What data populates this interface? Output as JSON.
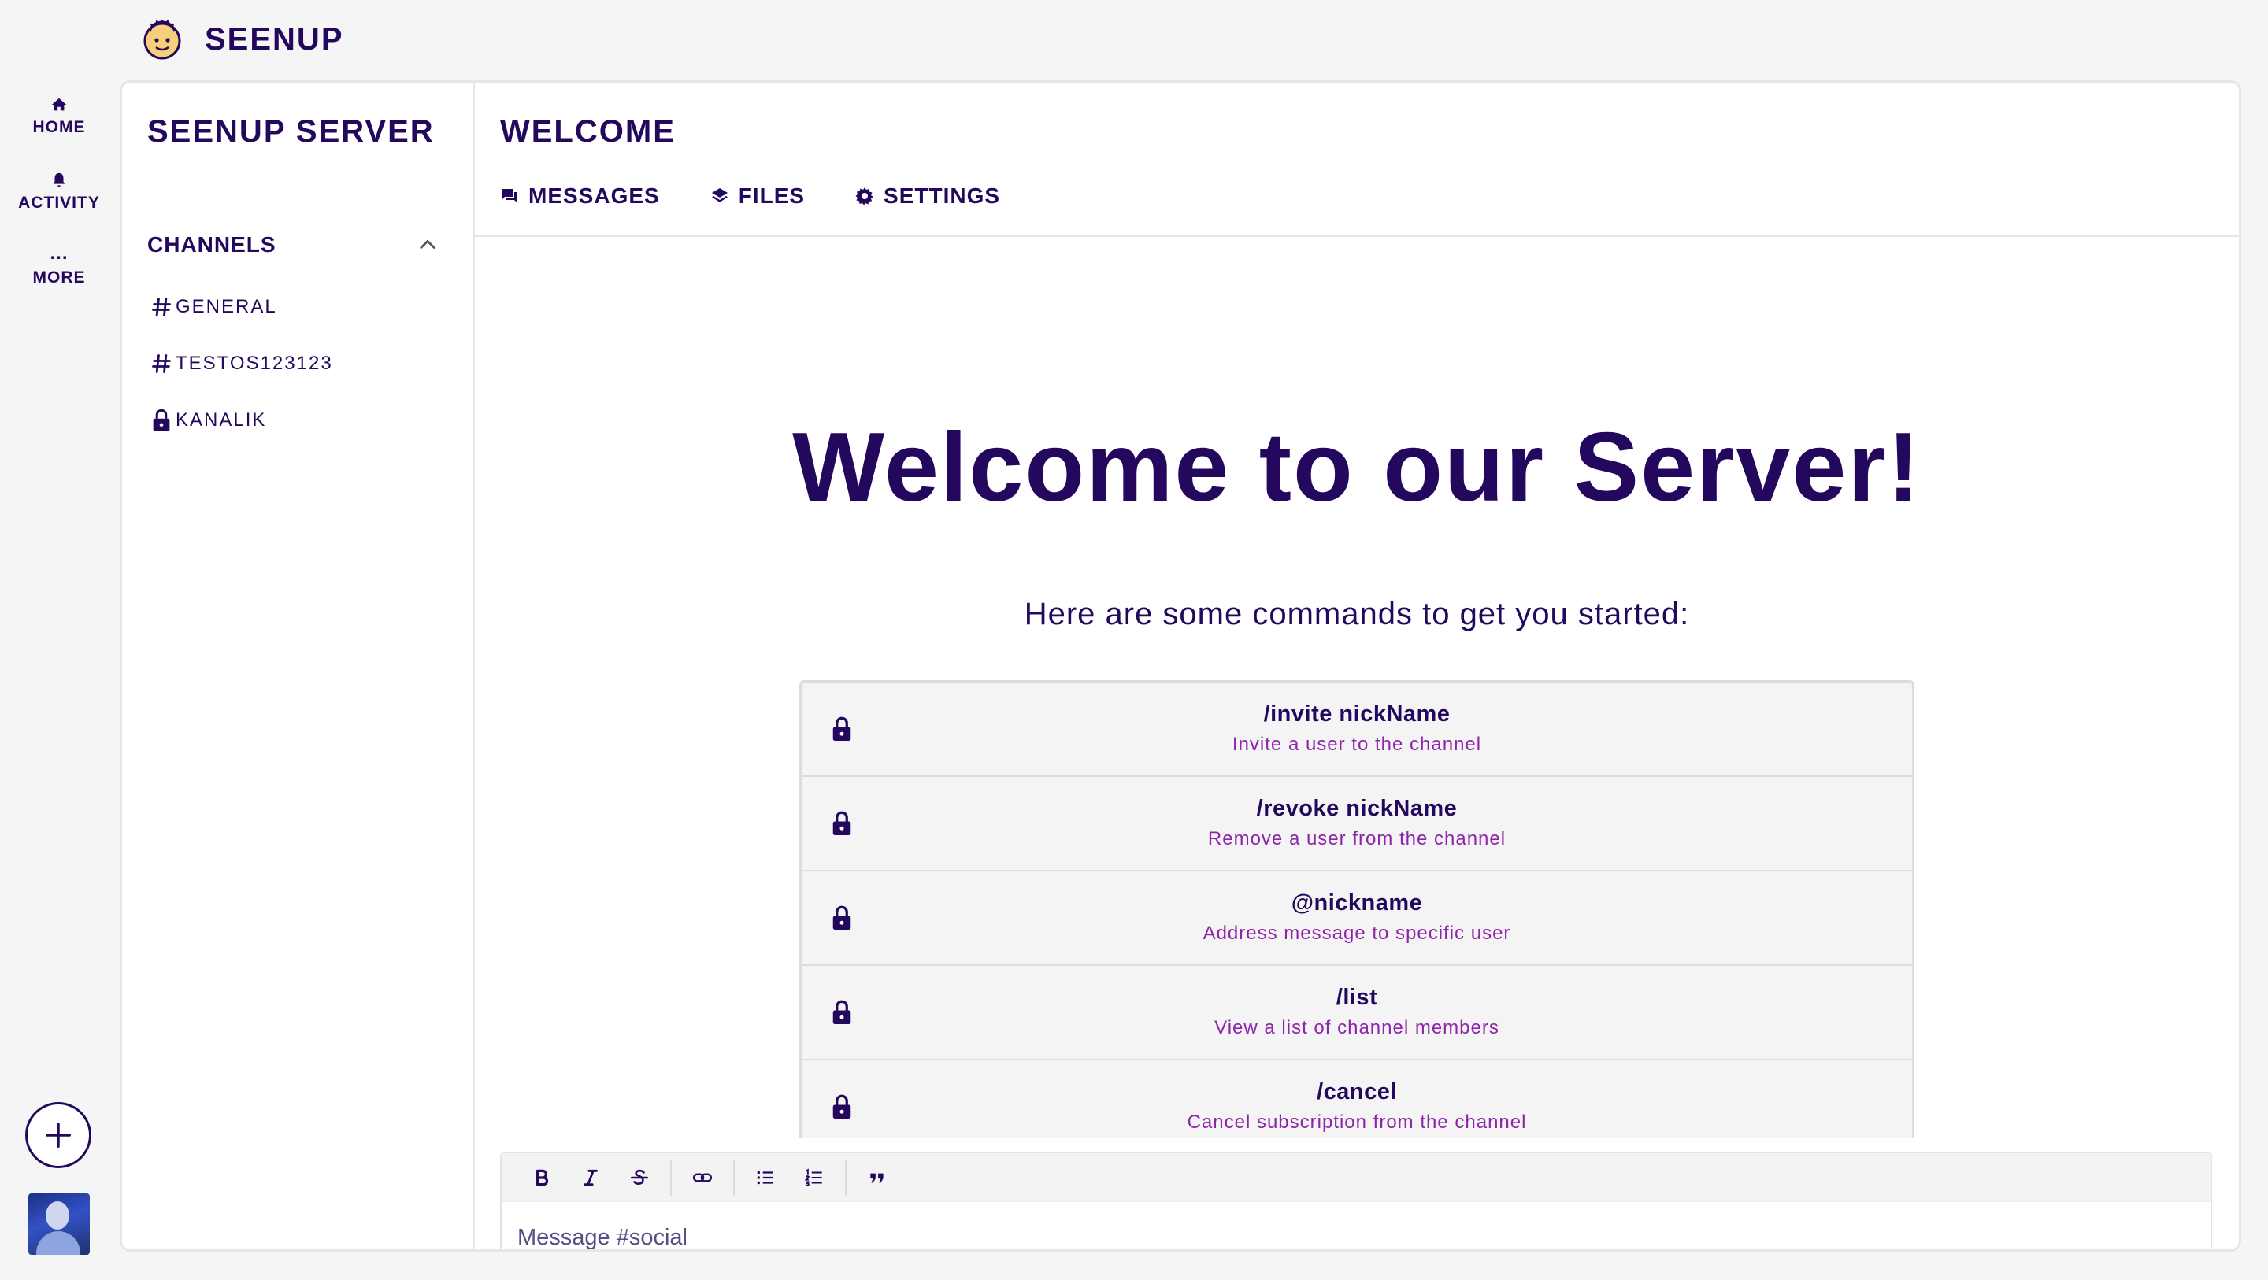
{
  "app": {
    "name": "SEENUP",
    "logo_icon": "smiley-mascot-icon"
  },
  "rail": {
    "items": [
      {
        "label": "HOME",
        "icon": "home-icon"
      },
      {
        "label": "ACTIVITY",
        "icon": "bell-icon"
      },
      {
        "label": "MORE",
        "icon": "more-dots-icon",
        "dots": "..."
      }
    ],
    "add_icon": "plus-circle-icon"
  },
  "server": {
    "title": "SEENUP SERVER",
    "channels_heading": "CHANNELS",
    "channels": [
      {
        "name": "GENERAL",
        "icon": "hash-icon"
      },
      {
        "name": "TESTOS123123",
        "icon": "hash-icon"
      },
      {
        "name": "KANALIK",
        "icon": "lock-icon"
      }
    ]
  },
  "main": {
    "title": "WELCOME",
    "tabs": [
      {
        "label": "MESSAGES",
        "icon": "chat-icon"
      },
      {
        "label": "FILES",
        "icon": "layers-icon"
      },
      {
        "label": "SETTINGS",
        "icon": "gear-icon"
      }
    ],
    "welcome_title": "Welcome to our Server!",
    "welcome_subtitle": "Here are some commands to get you started:",
    "commands": [
      {
        "name": "/invite nickName",
        "desc": "Invite a user to the channel"
      },
      {
        "name": "/revoke nickName",
        "desc": "Remove a user from the channel"
      },
      {
        "name": "@nickname",
        "desc": "Address message to specific user"
      },
      {
        "name": "/list",
        "desc": "View a list of channel members"
      },
      {
        "name": "/cancel",
        "desc": "Cancel subscription from the channel"
      }
    ]
  },
  "composer": {
    "placeholder": "Message #social",
    "toolbar": [
      "bold-icon",
      "italic-icon",
      "strikethrough-icon",
      "link-icon",
      "bullet-list-icon",
      "numbered-list-icon",
      "quote-icon"
    ],
    "bottom_tools": [
      "plus-icon",
      "text-format-icon",
      "emoji-icon",
      "mention-icon"
    ],
    "send_icon": "send-icon"
  },
  "colors": {
    "primary": "#24085e",
    "accent": "#8e24aa",
    "background": "#f5f5f5",
    "border": "#e6e6e6"
  }
}
